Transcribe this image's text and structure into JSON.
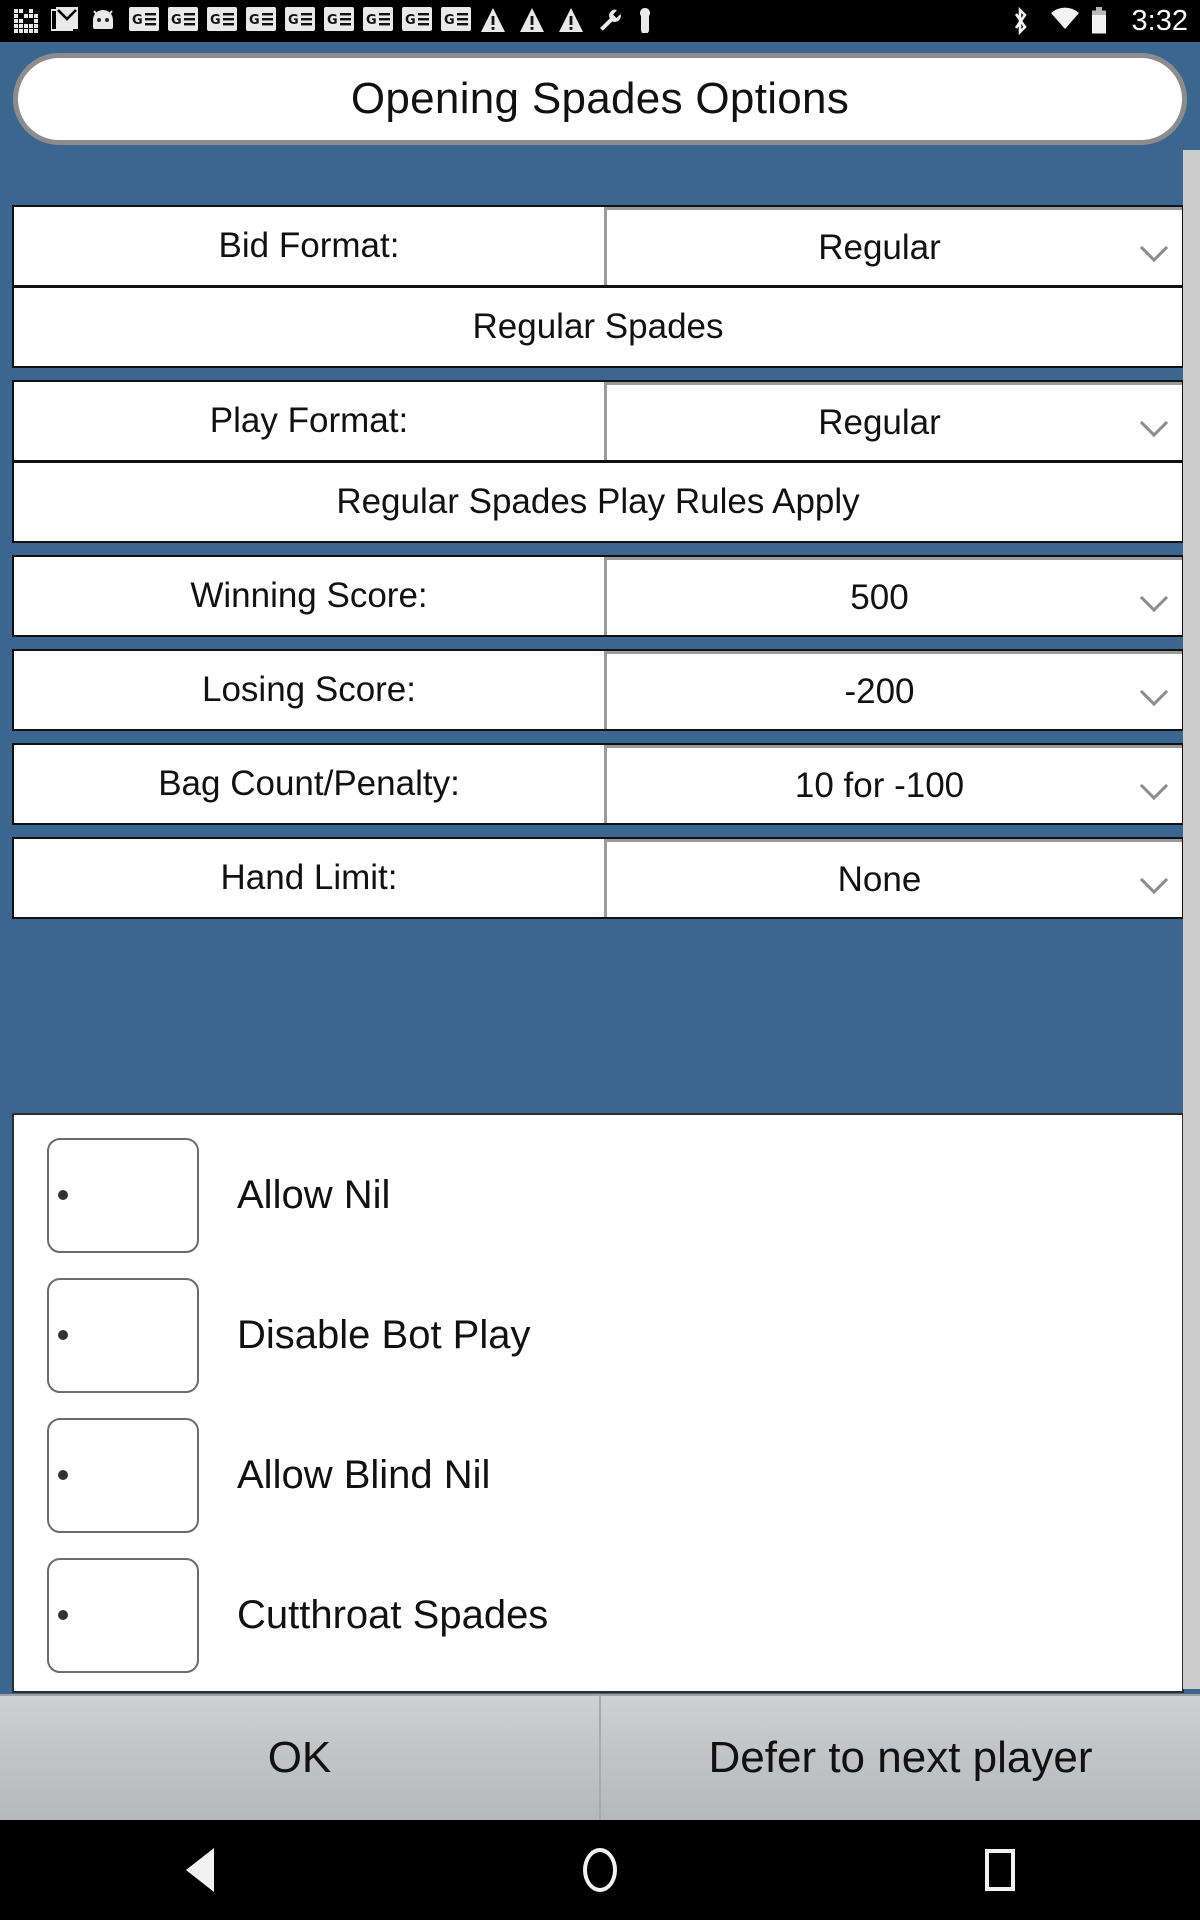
{
  "status_bar": {
    "time": "3:32",
    "left_icons": [
      "pixel-grid-icon",
      "gmail-icon",
      "android-head-icon",
      "ge-news-icon",
      "ge-news-icon",
      "ge-news-icon",
      "ge-news-icon",
      "ge-news-icon",
      "ge-news-icon",
      "ge-news-icon",
      "ge-news-icon",
      "ge-news-icon",
      "warning-triangle-icon",
      "warning-triangle-icon",
      "warning-triangle-icon",
      "wrench-icon",
      "key-icon"
    ],
    "right_icons": [
      "bluetooth-icon",
      "wifi-icon",
      "battery-icon"
    ]
  },
  "title": "Opening Spades Options",
  "settings": [
    {
      "label": "Bid Format:",
      "value": "Regular",
      "description": "Regular Spades"
    },
    {
      "label": "Play Format:",
      "value": "Regular",
      "description": "Regular Spades Play Rules Apply"
    },
    {
      "label": "Winning Score:",
      "value": "500",
      "description": null
    },
    {
      "label": "Losing Score:",
      "value": "-200",
      "description": null
    },
    {
      "label": "Bag Count/Penalty:",
      "value": "10 for -100",
      "description": null
    },
    {
      "label": "Hand Limit:",
      "value": "None",
      "description": null
    }
  ],
  "checkboxes": [
    {
      "label": "Allow Nil",
      "checked": false
    },
    {
      "label": "Disable Bot Play",
      "checked": false
    },
    {
      "label": "Allow Blind Nil",
      "checked": false
    },
    {
      "label": "Cutthroat Spades",
      "checked": false
    }
  ],
  "buttons": {
    "ok": "OK",
    "defer": "Defer to next player"
  },
  "nav_bar": {
    "back": "back-triangle-icon",
    "home": "home-circle-icon",
    "recents": "recents-square-icon"
  },
  "colors": {
    "background_blue": "#3a6690",
    "panel_white": "#ffffff",
    "button_gray": "#c4c5c7",
    "scrollbar": "#cdcdcd",
    "status_bar": "#000000"
  }
}
